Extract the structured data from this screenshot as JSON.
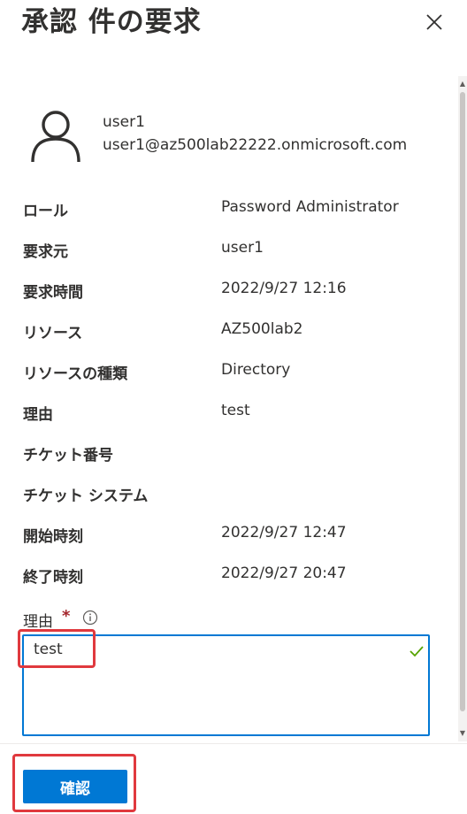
{
  "panel": {
    "title": "承認 件の要求"
  },
  "user": {
    "name": "user1",
    "email": "user1@az500lab22222.onmicrosoft.com"
  },
  "details": [
    {
      "label": "ロール",
      "value": "Password Administrator"
    },
    {
      "label": "要求元",
      "value": "user1"
    },
    {
      "label": "要求時間",
      "value": "2022/9/27 12:16"
    },
    {
      "label": "リソース",
      "value": "AZ500lab2"
    },
    {
      "label": "リソースの種類",
      "value": "Directory"
    },
    {
      "label": "理由",
      "value": "test"
    },
    {
      "label": "チケット番号",
      "value": ""
    },
    {
      "label": "チケット システム",
      "value": ""
    },
    {
      "label": "開始時刻",
      "value": "2022/9/27 12:47"
    },
    {
      "label": "終了時刻",
      "value": "2022/9/27 20:47"
    }
  ],
  "reason_field": {
    "label": "理由",
    "required_marker": "*",
    "value": "test"
  },
  "footer": {
    "confirm_label": "確認"
  },
  "icons": {
    "close": "close-icon",
    "avatar": "person-icon",
    "info": "info-icon",
    "check": "checkmark-icon"
  },
  "colors": {
    "accent": "#0078d4",
    "highlight": "#e0393e",
    "success": "#57a300",
    "required": "#a4262c"
  }
}
